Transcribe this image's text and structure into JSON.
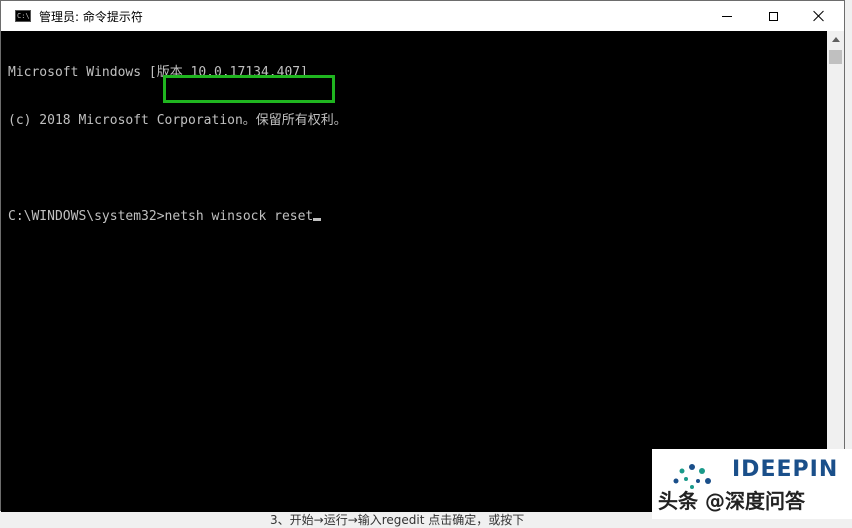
{
  "window": {
    "title": "管理员: 命令提示符",
    "icon_text": "C:\\"
  },
  "console": {
    "line1": "Microsoft Windows [版本 10.0.17134.407]",
    "line2": "(c) 2018 Microsoft Corporation。保留所有权利。",
    "prompt": "C:\\WINDOWS\\system32>",
    "command": "netsh winsock reset"
  },
  "highlight_color": "#1fb51f",
  "watermark": {
    "brand": "IDEEPIN",
    "handle": "头条 @深度问答"
  },
  "below_text": "3、开始→运行→输入regedit 点击确定，或按下"
}
